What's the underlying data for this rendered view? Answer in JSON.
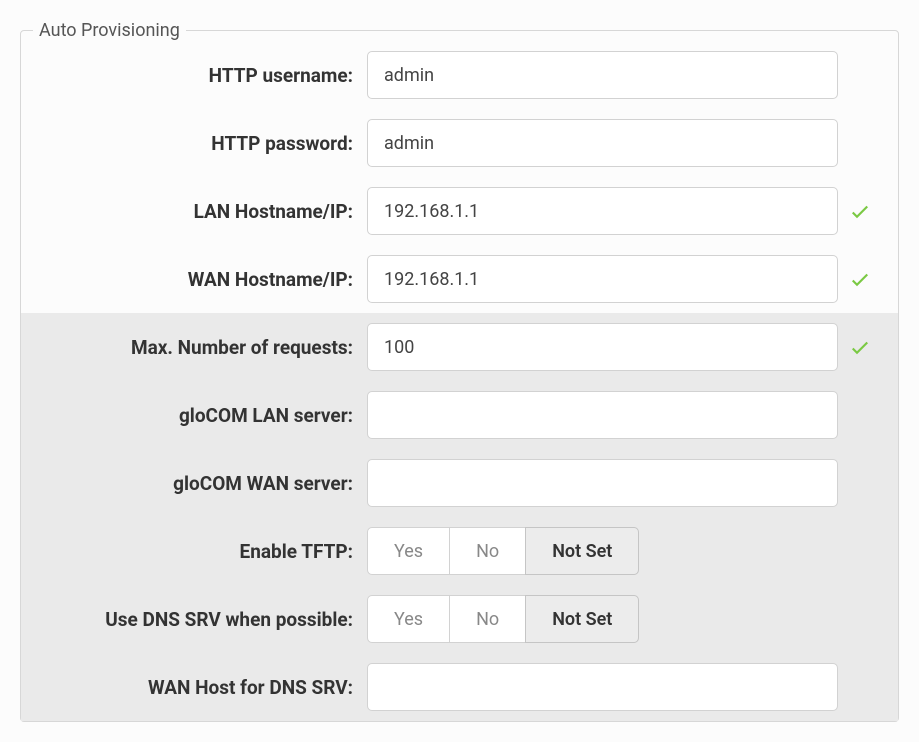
{
  "fieldset_legend": "Auto Provisioning",
  "rows": {
    "http_username": {
      "label": "HTTP username:",
      "value": "admin"
    },
    "http_password": {
      "label": "HTTP password:",
      "value": "admin"
    },
    "lan_hostname": {
      "label": "LAN Hostname/IP:",
      "value": "192.168.1.1",
      "valid": true
    },
    "wan_hostname": {
      "label": "WAN Hostname/IP:",
      "value": "192.168.1.1",
      "valid": true
    },
    "max_requests": {
      "label": "Max. Number of requests:",
      "value": "100",
      "valid": true
    },
    "glocom_lan": {
      "label": "gloCOM LAN server:",
      "value": ""
    },
    "glocom_wan": {
      "label": "gloCOM WAN server:",
      "value": ""
    },
    "enable_tftp": {
      "label": "Enable TFTP:",
      "options": {
        "yes": "Yes",
        "no": "No",
        "notset": "Not Set"
      },
      "selected": "notset"
    },
    "use_dns_srv": {
      "label": "Use DNS SRV when possible:",
      "options": {
        "yes": "Yes",
        "no": "No",
        "notset": "Not Set"
      },
      "selected": "notset"
    },
    "wan_host_srv": {
      "label": "WAN Host for DNS SRV:",
      "value": ""
    }
  },
  "colors": {
    "check": "#7ac943"
  }
}
